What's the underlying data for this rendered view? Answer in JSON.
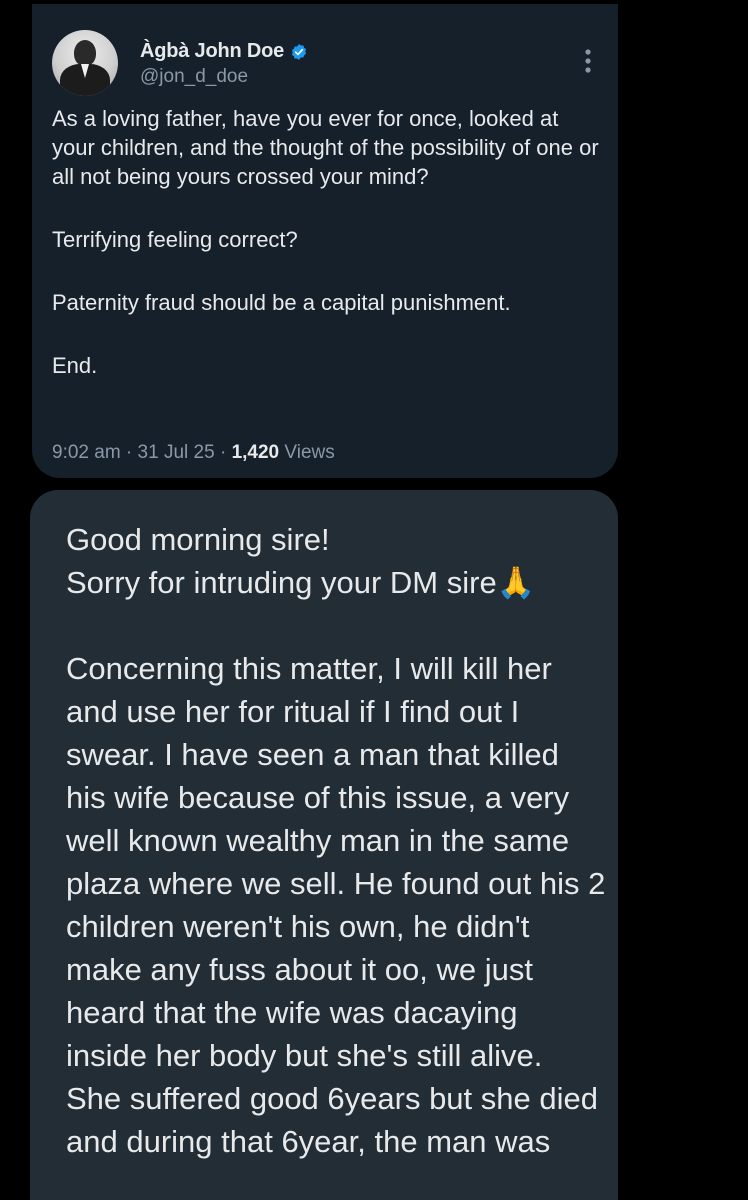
{
  "tweet": {
    "author": {
      "display_name": "Àgbà John Doe",
      "handle": "@jon_d_doe",
      "verified": true
    },
    "paragraphs": [
      "As a loving father, have you ever for once, looked at your children, and the thought of the possibility of one or all not being yours crossed your mind?",
      "Terrifying feeling correct?",
      "Paternity fraud should be a capital punishment.",
      "End."
    ],
    "time": "9:02 am",
    "date": "31 Jul 25",
    "separator": " · ",
    "views_count": "1,420",
    "views_label": " Views"
  },
  "dm": {
    "paragraphs": [
      "Good morning sire!\nSorry for intruding your DM sire🙏",
      "Concerning this matter, I will kill her and use her for ritual if I find out I swear.  I have seen a man that killed his wife because of this issue, a very well known wealthy man in the same plaza where we sell. He found out his 2 children weren't his own, he didn't make any fuss about it oo, we just heard that the wife was dacaying inside her body but she's still alive. She suffered good 6years but she died and during that 6year, the man was"
    ]
  },
  "colors": {
    "background": "#000000",
    "tweet_card": "#15202b",
    "dm_bubble": "#222d36",
    "text_primary": "#e7e9ea",
    "text_secondary": "#8b98a5",
    "verified_blue": "#1d9bf0"
  },
  "icons": {
    "verified": "verified-badge-icon",
    "more": "more-vertical-icon"
  }
}
